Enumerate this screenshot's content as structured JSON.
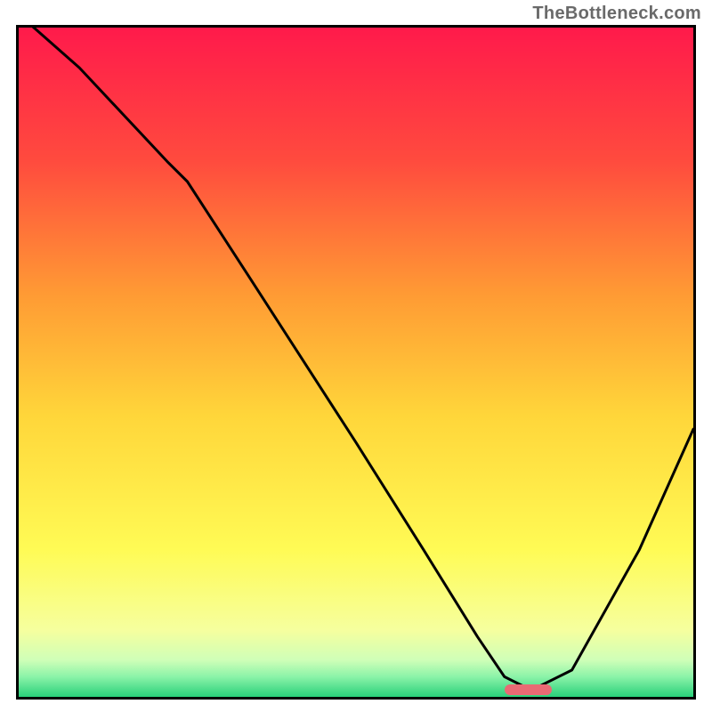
{
  "watermark": "TheBottleneck.com",
  "chart_data": {
    "type": "line",
    "title": "",
    "xlabel": "",
    "ylabel": "",
    "xlim": [
      0,
      100
    ],
    "ylim": [
      0,
      100
    ],
    "grid": false,
    "gradient_stops": [
      {
        "offset": 0.0,
        "color": "#ff1a4b"
      },
      {
        "offset": 0.2,
        "color": "#ff4b3e"
      },
      {
        "offset": 0.4,
        "color": "#ff9b34"
      },
      {
        "offset": 0.58,
        "color": "#ffd63a"
      },
      {
        "offset": 0.78,
        "color": "#fffb55"
      },
      {
        "offset": 0.9,
        "color": "#f6ff9e"
      },
      {
        "offset": 0.945,
        "color": "#cfffb8"
      },
      {
        "offset": 0.97,
        "color": "#8bf3a8"
      },
      {
        "offset": 1.0,
        "color": "#29d07a"
      }
    ],
    "series": [
      {
        "name": "bottleneck-curve",
        "x": [
          0,
          9,
          22,
          25,
          34,
          50,
          60,
          68,
          72,
          76,
          82,
          92,
          100
        ],
        "values": [
          102,
          94,
          80,
          77,
          63,
          38,
          22,
          9,
          3,
          1,
          4,
          22,
          40
        ]
      }
    ],
    "marker": {
      "name": "optimal-range",
      "x_start": 72,
      "x_end": 79,
      "y": 1
    }
  }
}
